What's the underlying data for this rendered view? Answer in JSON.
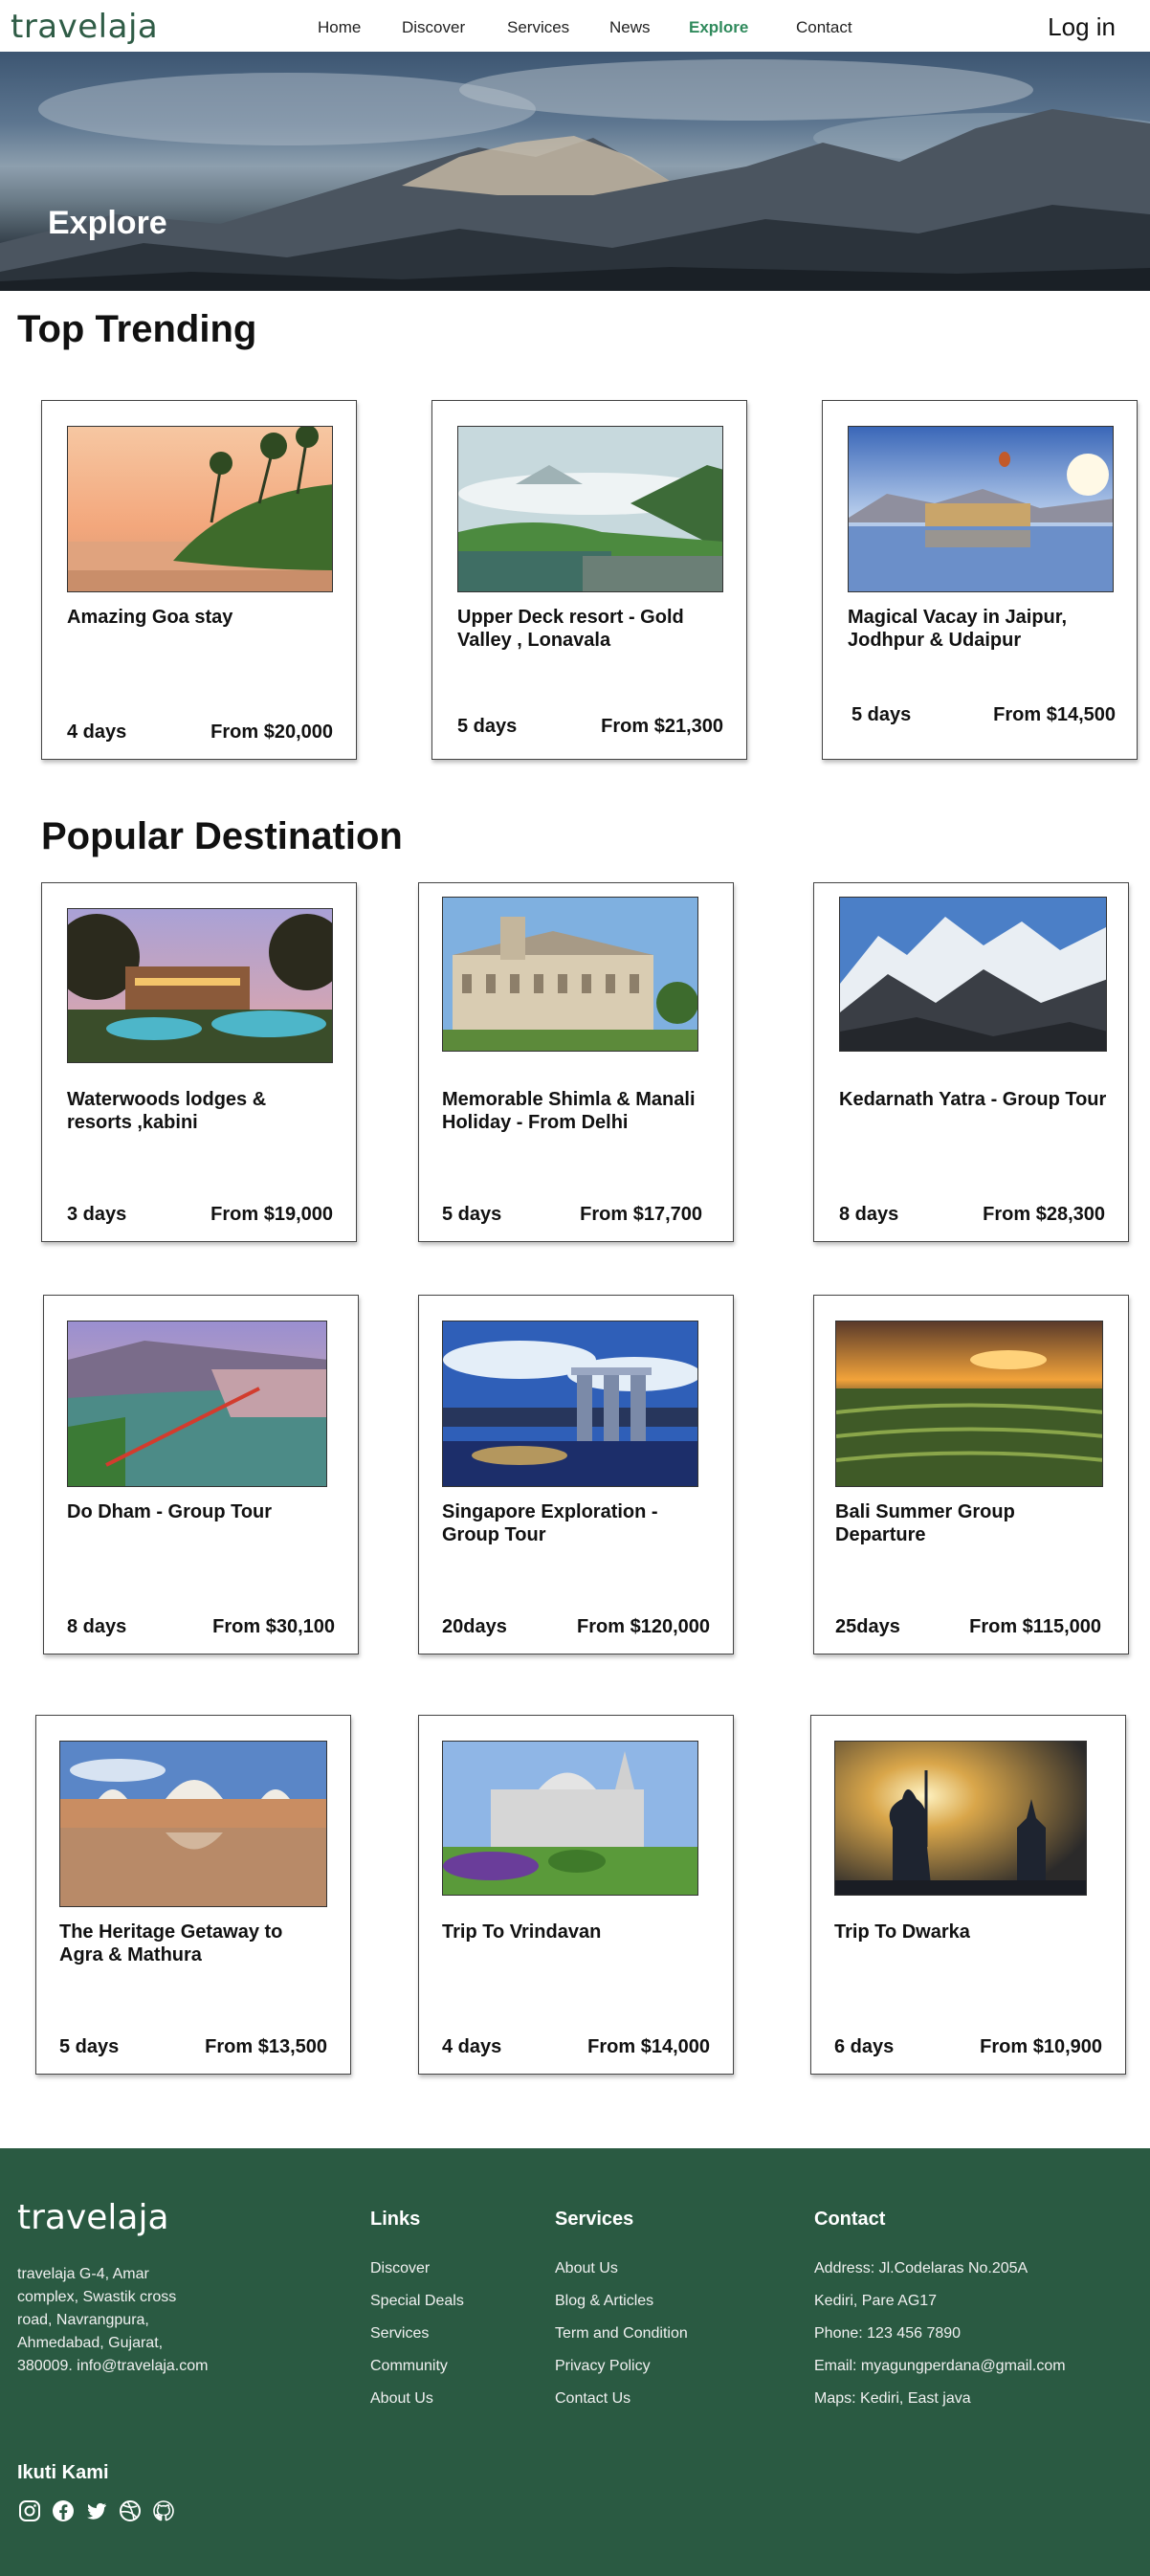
{
  "brand": "travelaja",
  "nav": {
    "links": [
      "Home",
      "Discover",
      "Services",
      "News",
      "Explore",
      "Contact"
    ],
    "active": "Explore",
    "login": "Log in"
  },
  "hero": {
    "title": "Explore"
  },
  "trending": {
    "title": "Top Trending",
    "cards": [
      {
        "title": "Amazing Goa stay",
        "days": "4 days",
        "price": "From $20,000",
        "image": "beach-sunset-palms"
      },
      {
        "title": "Upper Deck resort - Gold Valley , Lonavala",
        "days": "5 days",
        "price": "From $21,300",
        "image": "misty-valley-resort"
      },
      {
        "title": "Magical Vacay in Jaipur, Jodhpur & Udaipur",
        "days": "5 days",
        "price": "From $14,500",
        "image": "lake-palace-balloon"
      }
    ]
  },
  "popular": {
    "title": "Popular Destination",
    "cards": [
      {
        "title": "Waterwoods lodges & resorts ,kabini",
        "days": "3 days",
        "price": "From $19,000",
        "image": "resort-pool-dusk"
      },
      {
        "title": "Memorable Shimla & Manali Holiday - From Delhi",
        "days": "5 days",
        "price": "From $17,700",
        "image": "colonial-building"
      },
      {
        "title": "Kedarnath Yatra - Group Tour",
        "days": "8 days",
        "price": "From $28,300",
        "image": "snow-mountains"
      },
      {
        "title": "Do Dham - Group Tour",
        "days": "8 days",
        "price": "From $30,100",
        "image": "river-bridge-town"
      },
      {
        "title": "Singapore Exploration - Group Tour",
        "days": "20days",
        "price": "From $120,000",
        "image": "marina-bay-skyline"
      },
      {
        "title": "Bali Summer Group Departure",
        "days": "25days",
        "price": "From $115,000",
        "image": "rice-terraces-sunset"
      },
      {
        "title": "The Heritage Getaway to Agra & Mathura",
        "days": "5 days",
        "price": "From $13,500",
        "image": "palace-reflection"
      },
      {
        "title": "Trip To Vrindavan",
        "days": "4 days",
        "price": "From $14,000",
        "image": "white-temple-garden"
      },
      {
        "title": "Trip To Dwarka",
        "days": "6 days",
        "price": "From $10,900",
        "image": "shiva-statue-sunset"
      }
    ]
  },
  "footer": {
    "brand": "travelaja",
    "address": "travelaja G-4, Amar complex, Swastik cross road, Navrangpura, Ahmedabad, Gujarat, 380009. info@travelaja.com",
    "links": {
      "title": "Links",
      "items": [
        "Discover",
        "Special Deals",
        "Services",
        "Community",
        "About Us"
      ]
    },
    "services": {
      "title": "Services",
      "items": [
        "About Us",
        "Blog & Articles",
        "Term and Condition",
        "Privacy Policy",
        "Contact Us"
      ]
    },
    "contact": {
      "title": "Contact",
      "items": [
        "Address: Jl.Codelaras No.205A",
        "Kediri, Pare AG17",
        "Phone: 123 456 7890",
        "Email: myagungperdana@gmail.com",
        "Maps: Kediri, East java"
      ]
    },
    "follow": "Ikuti Kami",
    "social_icons": [
      "instagram-icon",
      "facebook-icon",
      "twitter-icon",
      "dribbble-icon",
      "github-icon"
    ]
  },
  "colors": {
    "brand_green": "#2f5c46",
    "footer_bg": "#2a5a42",
    "active_link": "#2f8a5c"
  }
}
